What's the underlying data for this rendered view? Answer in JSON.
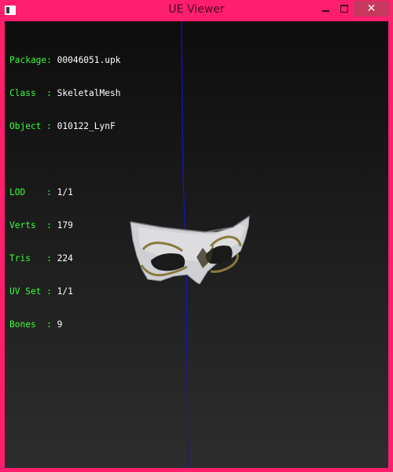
{
  "window": {
    "title": "UE Viewer",
    "close_glyph": "✕"
  },
  "info": {
    "group1": [
      {
        "label": "Package: ",
        "value": "00046051.upk"
      },
      {
        "label": "Class  : ",
        "value": "SkeletalMesh"
      },
      {
        "label": "Object : ",
        "value": "010122_LynF"
      }
    ],
    "group2": [
      {
        "label": "LOD    : ",
        "value": "1/1"
      },
      {
        "label": "Verts  : ",
        "value": "179"
      },
      {
        "label": "Tris   : ",
        "value": "224"
      },
      {
        "label": "UV Set : ",
        "value": "1/1"
      },
      {
        "label": "Bones  : ",
        "value": "9"
      }
    ]
  },
  "colors": {
    "frame": "#ff1f6e",
    "label": "#39ff39",
    "value": "#ffffff",
    "axis": "#1414c8"
  }
}
